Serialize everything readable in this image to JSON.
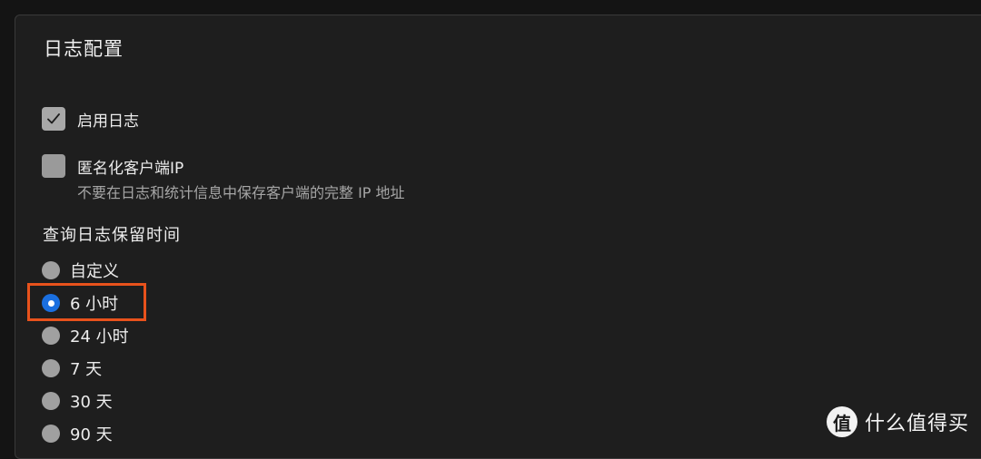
{
  "panel": {
    "title": "日志配置"
  },
  "options": {
    "enable_log": {
      "label": "启用日志",
      "checked": true
    },
    "anonymize_ip": {
      "label": "匿名化客户端IP",
      "checked": false,
      "hint": "不要在日志和统计信息中保存客户端的完整 IP 地址"
    }
  },
  "retention": {
    "label": "查询日志保留时间",
    "choices": [
      {
        "label": "自定义"
      },
      {
        "label": "6 小时"
      },
      {
        "label": "24 小时"
      },
      {
        "label": "7 天"
      },
      {
        "label": "30 天"
      },
      {
        "label": "90 天"
      }
    ],
    "selected": "6 小时"
  },
  "watermark": {
    "logo_char": "值",
    "text": "什么值得买"
  },
  "colors": {
    "background": "#141414",
    "panel": "#1e1e1e",
    "accent_blue": "#1a6fe0",
    "highlight_orange": "#e8521c"
  },
  "icons": {
    "checked": "checkmark-icon",
    "watermark": "zhidemai-logo-icon"
  }
}
